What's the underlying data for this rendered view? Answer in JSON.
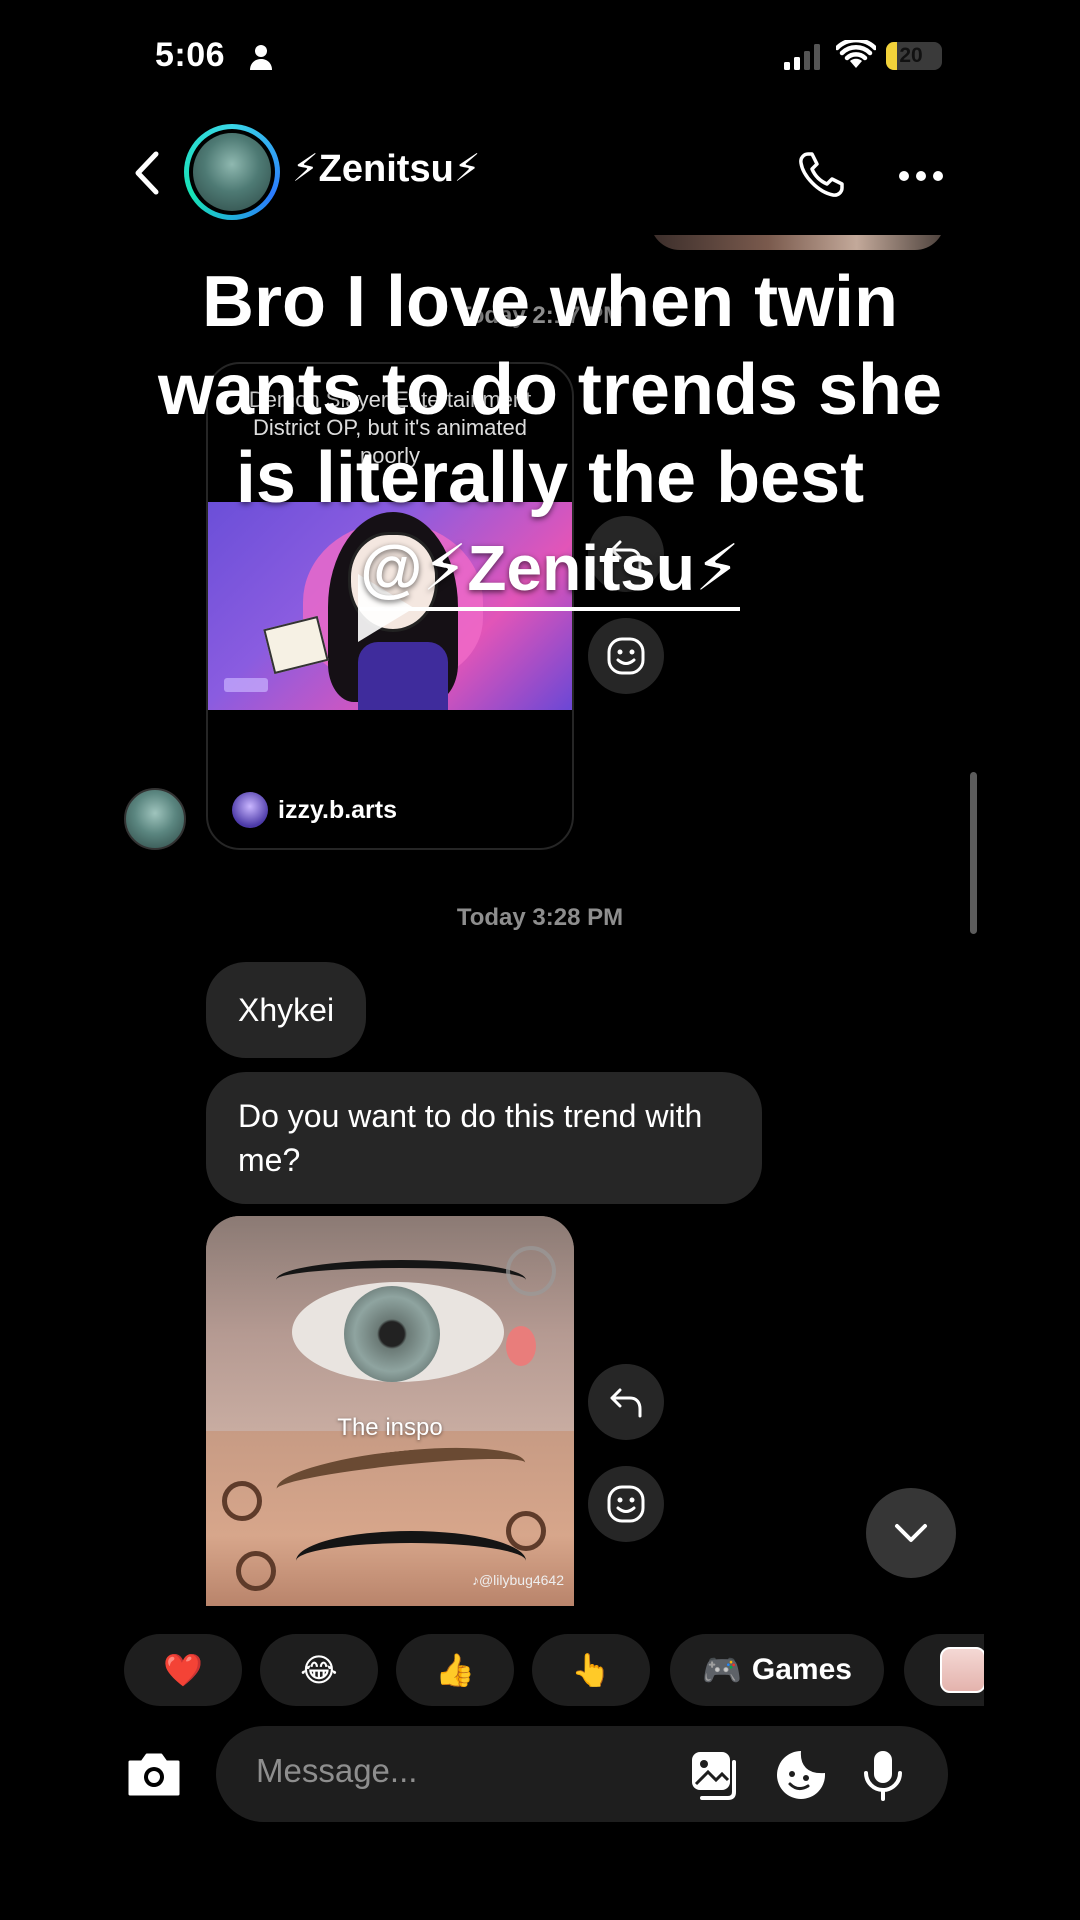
{
  "status_bar": {
    "time": "5:06",
    "battery": "20",
    "battery_level": 0.2
  },
  "header": {
    "name": "⚡Zenitsu⚡"
  },
  "messages": {
    "timestamp_1": "Today 2:17 PM",
    "shared_post": {
      "caption": "Demon Slayer Entertainment District OP, but it's animated poorly",
      "author": "izzy.b.arts"
    },
    "timestamp_2": "Today 3:28 PM",
    "bubble_1": "Xhykei",
    "bubble_2": "Do you want to do this trend with me?",
    "media": {
      "overlay_text": "The inspo",
      "watermark": "♪@lilybug4642"
    }
  },
  "overlay_caption": {
    "text": "Bro I love when twin wants to do trends she is literally the best",
    "mention": "@⚡Zenitsu⚡"
  },
  "reactions": [
    {
      "emoji": "❤️"
    },
    {
      "emoji": "😂"
    },
    {
      "emoji": "👍"
    },
    {
      "emoji": "👆"
    },
    {
      "emoji": "🎮",
      "label": "Games"
    }
  ],
  "composer": {
    "placeholder": "Message..."
  },
  "colors": {
    "background": "#000000",
    "bubble": "#262626",
    "secondary_text": "#8e8e8e",
    "chip": "#1e1e1e"
  }
}
